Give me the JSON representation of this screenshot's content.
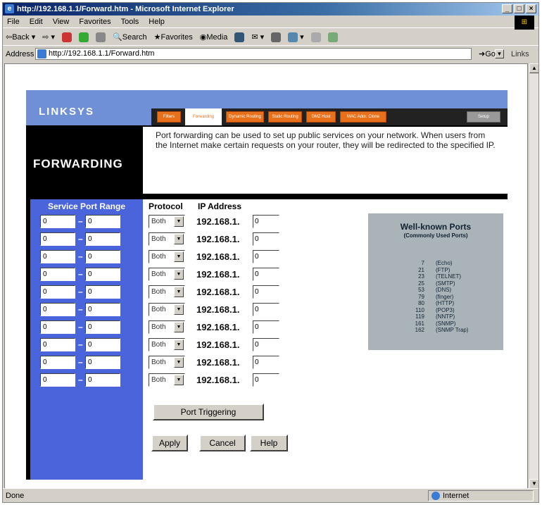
{
  "window": {
    "title": "http://192.168.1.1/Forward.htm - Microsoft Internet Explorer",
    "controls": [
      "_",
      "□",
      "×"
    ]
  },
  "menu": [
    "File",
    "Edit",
    "View",
    "Favorites",
    "Tools",
    "Help"
  ],
  "toolbar": {
    "back": "Back",
    "search": "Search",
    "favorites": "Favorites",
    "media": "Media"
  },
  "address": {
    "label": "Address",
    "url": "http://192.168.1.1/Forward.htm",
    "go": "Go",
    "links": "Links"
  },
  "status": {
    "left": "Done",
    "zone": "Internet"
  },
  "linksys": {
    "logo": "LINKSYS",
    "tabs": [
      "Filters",
      "Forwarding",
      "Dynamic Routing",
      "Static Routing",
      "DMZ Host",
      "MAC Addr. Clone",
      "Setup"
    ],
    "active_tab": "Forwarding",
    "page_title": "FORWARDING",
    "description": "Port forwarding can be used to set up public services on your network. When users from the Internet make certain requests on your router, they will be redirected to the specified IP.",
    "col_service_port_range": "Service Port Range",
    "col_protocol": "Protocol",
    "col_ip": "IP Address",
    "ip_prefix": "192.168.1.",
    "rows": [
      {
        "start": "0",
        "end": "0",
        "protocol": "Both",
        "ip": "0"
      },
      {
        "start": "0",
        "end": "0",
        "protocol": "Both",
        "ip": "0"
      },
      {
        "start": "0",
        "end": "0",
        "protocol": "Both",
        "ip": "0"
      },
      {
        "start": "0",
        "end": "0",
        "protocol": "Both",
        "ip": "0"
      },
      {
        "start": "0",
        "end": "0",
        "protocol": "Both",
        "ip": "0"
      },
      {
        "start": "0",
        "end": "0",
        "protocol": "Both",
        "ip": "0"
      },
      {
        "start": "0",
        "end": "0",
        "protocol": "Both",
        "ip": "0"
      },
      {
        "start": "0",
        "end": "0",
        "protocol": "Both",
        "ip": "0"
      },
      {
        "start": "0",
        "end": "0",
        "protocol": "Both",
        "ip": "0"
      },
      {
        "start": "0",
        "end": "0",
        "protocol": "Both",
        "ip": "0"
      }
    ],
    "well_known": {
      "title": "Well-known Ports",
      "subtitle": "(Commonly Used Ports)",
      "ports": [
        {
          "port": "7",
          "name": "(Echo)"
        },
        {
          "port": "21",
          "name": "(FTP)"
        },
        {
          "port": "23",
          "name": "(TELNET)"
        },
        {
          "port": "25",
          "name": "(SMTP)"
        },
        {
          "port": "53",
          "name": "(DNS)"
        },
        {
          "port": "79",
          "name": "(finger)"
        },
        {
          "port": "80",
          "name": "(HTTP)"
        },
        {
          "port": "110",
          "name": "(POP3)"
        },
        {
          "port": "119",
          "name": "(NNTP)"
        },
        {
          "port": "161",
          "name": "(SNMP)"
        },
        {
          "port": "162",
          "name": "(SNMP Trap)"
        }
      ]
    },
    "buttons": {
      "port_triggering": "Port Triggering",
      "apply": "Apply",
      "cancel": "Cancel",
      "help": "Help"
    },
    "colors": {
      "blue": "#4a64dc",
      "tab_orange": "#e8701a",
      "header_blue": "#6f8fd6"
    }
  }
}
